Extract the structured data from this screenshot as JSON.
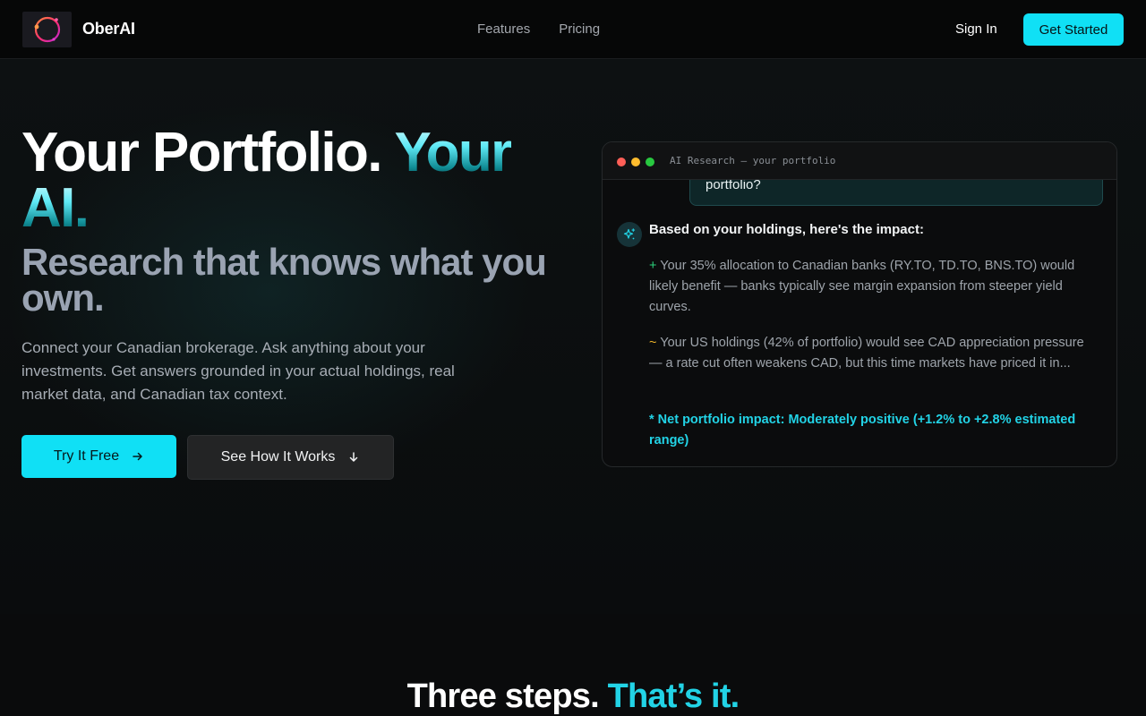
{
  "nav": {
    "brand": "OberAI",
    "links": [
      "Features",
      "Pricing"
    ],
    "sign_in": "Sign In",
    "get_started": "Get Started"
  },
  "hero": {
    "title_main": "Your Portfolio.",
    "title_accent": "Your AI.",
    "subtitle": "Research that knows what you own.",
    "description": "Connect your Canadian brokerage. Ask anything about your investments. Get answers grounded in your actual holdings, real market data, and Canadian tax context.",
    "cta_primary": "Try It Free",
    "cta_secondary": "See How It Works"
  },
  "panel": {
    "title": "AI Research — your portfolio",
    "user_message_visible": "portfolio?",
    "ai_heading": "Based on your holdings, here's the impact:",
    "points": [
      {
        "marker": "+",
        "text": "Your 35% allocation to Canadian banks (RY.TO, TD.TO, BNS.TO) would likely benefit — banks typically see margin expansion from steeper yield curves."
      },
      {
        "marker": "~",
        "text": "Your US holdings (42% of portfolio) would see CAD appreciation pressure — a rate cut often weakens CAD, but this time markets have priced it in..."
      }
    ],
    "net_impact": "* Net portfolio impact: Moderately positive (+1.2% to +2.8% estimated range)"
  },
  "section": {
    "title_main": "Three steps.",
    "title_accent": "That’s it."
  },
  "colors": {
    "accent": "#10e0f5",
    "background": "#0a0b0c",
    "plus": "#2bd27c",
    "tilde": "#f0b429",
    "dot_red": "#ff5f57",
    "dot_yellow": "#febc2e",
    "dot_green": "#28c840"
  }
}
